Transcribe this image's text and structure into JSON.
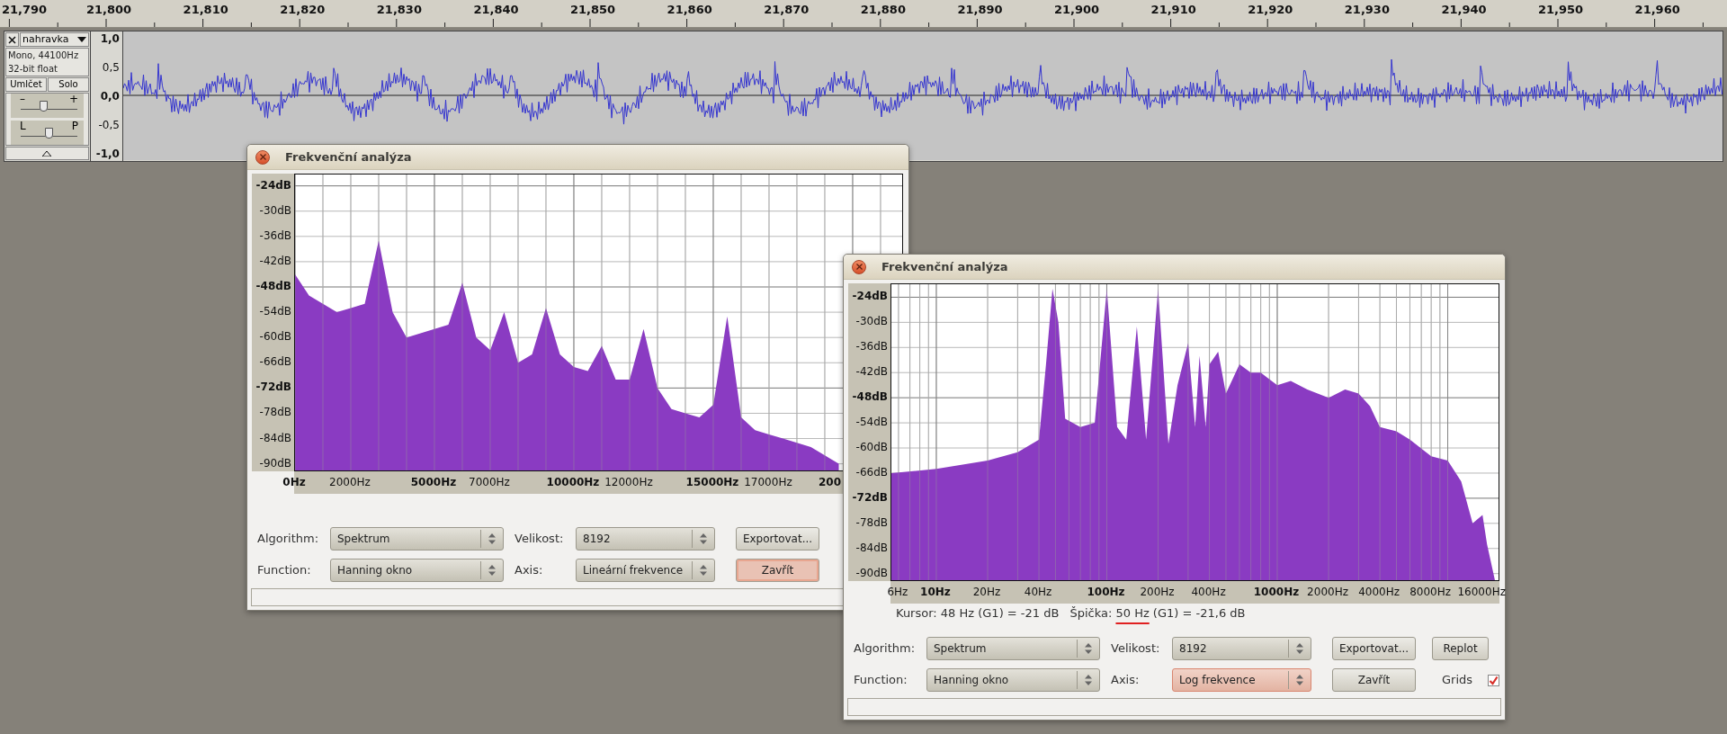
{
  "ruler": {
    "labels": [
      "21,790",
      "21,800",
      "21,810",
      "21,820",
      "21,830",
      "21,840",
      "21,850",
      "21,860",
      "21,870",
      "21,880",
      "21,890",
      "21,900",
      "21,910",
      "21,920",
      "21,930",
      "21,940",
      "21,950",
      "21,960"
    ]
  },
  "track": {
    "name": "nahravka",
    "info": [
      "Mono, 44100Hz",
      "32-bit float"
    ],
    "buttons": [
      "Umlčet",
      "Solo"
    ],
    "sliders": [
      {
        "left": "–",
        "right": "+",
        "level": 0.39
      },
      {
        "left": "L",
        "right": "P",
        "level": 0.5
      }
    ],
    "scale": [
      "1,0",
      "0,5",
      "0,0",
      "-0,5",
      "-1,0"
    ]
  },
  "dialogs": [
    {
      "title": "Frekvenční analýza",
      "x_label_cut": "200",
      "chart_data": {
        "type": "area",
        "grid": true,
        "xlim": [
          0,
          21840
        ],
        "ylim": [
          -92,
          -21.3
        ],
        "x": [
          0,
          500,
          1000,
          1500,
          2000,
          2500,
          3000,
          3500,
          4000,
          4500,
          5000,
          5500,
          6000,
          6500,
          7000,
          7500,
          8000,
          8500,
          9000,
          9500,
          10000,
          10500,
          11000,
          11500,
          12000,
          12500,
          13000,
          13500,
          14000,
          14500,
          15000,
          15500,
          16000,
          16500,
          17000,
          17500,
          18000,
          18500,
          19000,
          19500
        ],
        "series": [
          {
            "color": "#8a3bc2",
            "values": [
              -45,
              -50,
              -52,
              -54,
              -53,
              -52,
              -37,
              -54,
              -60,
              -59,
              -58,
              -57,
              -47,
              -60,
              -63,
              -54,
              -66,
              -64,
              -53,
              -64,
              -67,
              -68,
              -62,
              -70,
              -70,
              -58,
              -72,
              -77,
              -78,
              -79,
              -76,
              -55,
              -79,
              -82,
              -83,
              -84,
              -85,
              -86,
              -88,
              -90
            ]
          }
        ],
        "xticks": [
          {
            "value": 0,
            "label": "0Hz"
          },
          {
            "value": 2000,
            "label": "2000Hz"
          },
          {
            "value": 5000,
            "label": "5000Hz"
          },
          {
            "value": 7000,
            "label": "7000Hz"
          },
          {
            "value": 10000,
            "label": "10000Hz"
          },
          {
            "value": 12000,
            "label": "12000Hz"
          },
          {
            "value": 15000,
            "label": "15000Hz"
          },
          {
            "value": 17000,
            "label": "17000Hz"
          }
        ],
        "yticks": [
          {
            "value": -24,
            "label": "-24dB"
          },
          {
            "value": -30,
            "label": "-30dB"
          },
          {
            "value": -36,
            "label": "-36dB"
          },
          {
            "value": -42,
            "label": "-42dB"
          },
          {
            "value": -48,
            "label": "-48dB"
          },
          {
            "value": -54,
            "label": "-54dB"
          },
          {
            "value": -60,
            "label": "-60dB"
          },
          {
            "value": -66,
            "label": "-66dB"
          },
          {
            "value": -72,
            "label": "-72dB"
          },
          {
            "value": -78,
            "label": "-78dB"
          },
          {
            "value": -84,
            "label": "-84dB"
          },
          {
            "value": -90,
            "label": "-90dB"
          }
        ]
      },
      "controls": [
        [
          {
            "kind": "label",
            "text": "Algorithm:"
          },
          {
            "kind": "select",
            "value": "Spektrum",
            "focused": false
          },
          {
            "kind": "label",
            "text": "Velikost:"
          },
          {
            "kind": "select",
            "value": "8192",
            "focused": false
          },
          {
            "kind": "button",
            "label": "Exportovat...",
            "focused": false
          }
        ],
        [
          {
            "kind": "label",
            "text": "Function:"
          },
          {
            "kind": "select",
            "value": "Hanning okno",
            "focused": false
          },
          {
            "kind": "label",
            "text": "Axis:"
          },
          {
            "kind": "select",
            "value": "Lineární frekvence",
            "focused": false
          },
          {
            "kind": "button",
            "label": "Zavřít",
            "focused": true
          }
        ]
      ]
    },
    {
      "title": "Frekvenční analýza",
      "plot": {
        "y_labels": [
          "-24dB",
          "-30dB",
          "-36dB",
          "-42dB",
          "-48dB",
          "-54dB",
          "-60dB",
          "-66dB",
          "-72dB",
          "-78dB",
          "-84dB",
          "-90dB"
        ],
        "x_labels": [
          "6Hz",
          "10Hz",
          "20Hz",
          "40Hz",
          "100Hz",
          "200Hz",
          "400Hz",
          "1000Hz",
          "2000Hz",
          "4000Hz",
          "8000Hz",
          "16000Hz"
        ]
      },
      "readout": {
        "cursor": "Kursor: 48 Hz (G1) = -21 dB",
        "peak_before": "Špička: ",
        "peak_marked": "50 Hz",
        "peak_after": " (G1) = -21,6 dB"
      },
      "controls": [
        [
          {
            "kind": "label",
            "text": "Algorithm:"
          },
          {
            "kind": "select",
            "value": "Spektrum",
            "focused": false
          },
          {
            "kind": "label",
            "text": "Velikost:"
          },
          {
            "kind": "select",
            "value": "8192",
            "focused": false
          },
          {
            "kind": "button",
            "label": "Exportovat...",
            "focused": false
          },
          {
            "kind": "button",
            "label": "Replot",
            "focused": false
          }
        ],
        [
          {
            "kind": "label",
            "text": "Function:"
          },
          {
            "kind": "select",
            "value": "Hanning okno",
            "focused": false
          },
          {
            "kind": "label",
            "text": "Axis:"
          },
          {
            "kind": "select",
            "value": "Log frekvence",
            "focused": true
          },
          {
            "kind": "button",
            "label": "Zavřít",
            "focused": false
          },
          {
            "kind": "checkbox",
            "label": "Grids",
            "checked": true
          }
        ]
      ]
    }
  ]
}
